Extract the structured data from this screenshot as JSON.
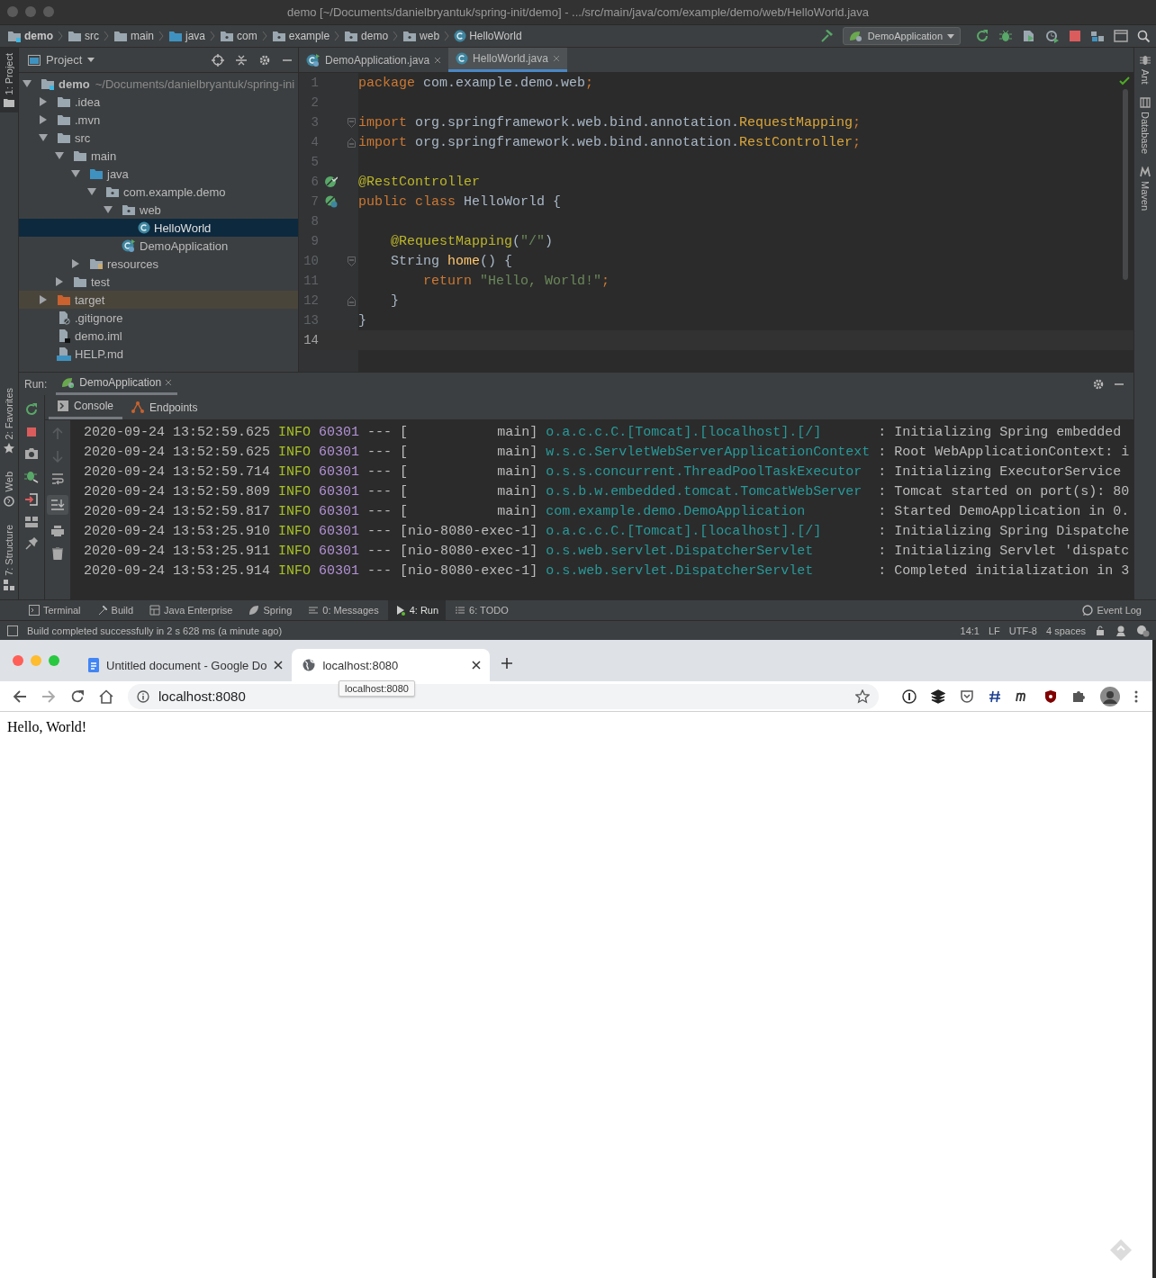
{
  "ide": {
    "title": "demo [~/Documents/danielbryantuk/spring-init/demo] - .../src/main/java/com/example/demo/web/HelloWorld.java",
    "breadcrumbs": [
      {
        "label": "demo",
        "kind": "module"
      },
      {
        "label": "src",
        "kind": "folder"
      },
      {
        "label": "main",
        "kind": "folder"
      },
      {
        "label": "java",
        "kind": "source-folder"
      },
      {
        "label": "com",
        "kind": "package"
      },
      {
        "label": "example",
        "kind": "package"
      },
      {
        "label": "demo",
        "kind": "package"
      },
      {
        "label": "web",
        "kind": "package"
      },
      {
        "label": "HelloWorld",
        "kind": "class"
      }
    ],
    "run_config": "DemoApplication",
    "left_tool_windows": [
      {
        "label": "1: Project",
        "selected": true,
        "kind": "project"
      },
      {
        "label": "2: Favorites",
        "selected": false,
        "kind": "favorites"
      },
      {
        "label": "Web",
        "selected": false,
        "kind": "web"
      },
      {
        "label": "7: Structure",
        "selected": false,
        "kind": "structure"
      }
    ],
    "right_tool_windows": [
      {
        "label": "Ant",
        "kind": "ant"
      },
      {
        "label": "Database",
        "kind": "database"
      },
      {
        "label": "Maven",
        "kind": "maven"
      }
    ],
    "project_panel": {
      "title": "Project",
      "tree": [
        {
          "label": "demo",
          "path": "~/Documents/danielbryantuk/spring-ini",
          "kind": "module",
          "expanded": true,
          "selected": false,
          "children": [
            {
              "label": ".idea",
              "kind": "folder",
              "expanded": false,
              "selected": false
            },
            {
              "label": ".mvn",
              "kind": "folder",
              "expanded": false,
              "selected": false
            },
            {
              "label": "src",
              "kind": "folder",
              "expanded": true,
              "selected": false,
              "children": [
                {
                  "label": "main",
                  "kind": "folder",
                  "expanded": true,
                  "selected": false,
                  "children": [
                    {
                      "label": "java",
                      "kind": "source-folder",
                      "expanded": true,
                      "selected": false,
                      "children": [
                        {
                          "label": "com.example.demo",
                          "kind": "package",
                          "expanded": true,
                          "selected": false,
                          "children": [
                            {
                              "label": "web",
                              "kind": "package",
                              "expanded": true,
                              "selected": false,
                              "children": [
                                {
                                  "label": "HelloWorld",
                                  "kind": "class",
                                  "selected": true
                                }
                              ]
                            },
                            {
                              "label": "DemoApplication",
                              "kind": "spring-app",
                              "selected": false
                            }
                          ]
                        }
                      ]
                    },
                    {
                      "label": "resources",
                      "kind": "resources-folder",
                      "expanded": false,
                      "selected": false
                    }
                  ]
                },
                {
                  "label": "test",
                  "kind": "folder",
                  "expanded": false,
                  "selected": false
                }
              ]
            },
            {
              "label": "target",
              "kind": "excluded-folder",
              "expanded": false,
              "selected": false
            },
            {
              "label": ".gitignore",
              "kind": "ignore-file",
              "selected": false
            },
            {
              "label": "demo.iml",
              "kind": "iml-file",
              "selected": false
            },
            {
              "label": "HELP.md",
              "kind": "md-file",
              "selected": false
            }
          ]
        }
      ]
    },
    "editor": {
      "tabs": [
        {
          "label": "DemoApplication.java",
          "kind": "spring-app",
          "selected": false
        },
        {
          "label": "HelloWorld.java",
          "kind": "class",
          "selected": true
        }
      ],
      "lines": [
        {
          "number": "1",
          "current": false,
          "tokens": [
            {
              "kind": "keyword",
              "text": "package"
            },
            {
              "kind": "plain",
              "text": " com.example.demo.web"
            },
            {
              "kind": "keyword",
              "text": ";"
            }
          ]
        },
        {
          "number": "2",
          "current": false
        },
        {
          "number": "3",
          "current": false,
          "fold": {
            "kind": "start"
          },
          "tokens": [
            {
              "kind": "keyword",
              "text": "import"
            },
            {
              "kind": "plain",
              "text": " org.springframework.web.bind.annotation."
            },
            {
              "kind": "class-ref",
              "text": "RequestMapping"
            },
            {
              "kind": "keyword",
              "text": ";"
            }
          ]
        },
        {
          "number": "4",
          "current": false,
          "fold": {
            "kind": "end"
          },
          "tokens": [
            {
              "kind": "keyword",
              "text": "import"
            },
            {
              "kind": "plain",
              "text": " org.springframework.web.bind.annotation."
            },
            {
              "kind": "class-ref",
              "text": "RestController"
            },
            {
              "kind": "keyword",
              "text": ";"
            }
          ]
        },
        {
          "number": "5",
          "current": false
        },
        {
          "number": "6",
          "current": false,
          "gutter_icon": {
            "kind": "bean"
          },
          "tokens": [
            {
              "kind": "annotation",
              "text": "@RestController"
            }
          ]
        },
        {
          "number": "7",
          "current": false,
          "gutter_icon": {
            "kind": "bean-class"
          },
          "tokens": [
            {
              "kind": "keyword",
              "text": "public class"
            },
            {
              "kind": "plain",
              "text": " HelloWorld {"
            }
          ]
        },
        {
          "number": "8",
          "current": false
        },
        {
          "number": "9",
          "current": false,
          "tokens": [
            {
              "kind": "annotation",
              "text": "    @RequestMapping"
            },
            {
              "kind": "plain",
              "text": "("
            },
            {
              "kind": "string",
              "text": "\"/\""
            },
            {
              "kind": "plain",
              "text": ")"
            }
          ]
        },
        {
          "number": "10",
          "current": false,
          "fold": {
            "kind": "start"
          },
          "tokens": [
            {
              "kind": "plain",
              "text": "    String "
            },
            {
              "kind": "method",
              "text": "home"
            },
            {
              "kind": "plain",
              "text": "() {"
            }
          ]
        },
        {
          "number": "11",
          "current": false,
          "tokens": [
            {
              "kind": "keyword",
              "text": "        return"
            },
            {
              "kind": "string",
              "text": " \"Hello, World!\""
            },
            {
              "kind": "keyword",
              "text": ";"
            }
          ]
        },
        {
          "number": "12",
          "current": false,
          "fold": {
            "kind": "end"
          },
          "tokens": [
            {
              "kind": "plain",
              "text": "    }"
            }
          ]
        },
        {
          "number": "13",
          "current": false,
          "tokens": [
            {
              "kind": "plain",
              "text": "}"
            }
          ]
        },
        {
          "number": "14",
          "current": true
        }
      ]
    },
    "run_panel": {
      "label": "Run:",
      "tab": "DemoApplication",
      "subtabs": [
        {
          "label": "Console",
          "kind": "console",
          "selected": true
        },
        {
          "label": "Endpoints",
          "kind": "endpoints",
          "selected": false
        }
      ],
      "log": [
        {
          "time": "2020-09-24 13:52:59.625",
          "level": "INFO",
          "pid": "60301",
          "sep": "---",
          "thread": "[           main]",
          "logger": "o.a.c.c.C.[Tomcat].[localhost].[/]",
          "message": ": Initializing Spring embedded"
        },
        {
          "time": "2020-09-24 13:52:59.625",
          "level": "INFO",
          "pid": "60301",
          "sep": "---",
          "thread": "[           main]",
          "logger": "w.s.c.ServletWebServerApplicationContext",
          "message": ": Root WebApplicationContext: i"
        },
        {
          "time": "2020-09-24 13:52:59.714",
          "level": "INFO",
          "pid": "60301",
          "sep": "---",
          "thread": "[           main]",
          "logger": "o.s.s.concurrent.ThreadPoolTaskExecutor",
          "message": ": Initializing ExecutorService"
        },
        {
          "time": "2020-09-24 13:52:59.809",
          "level": "INFO",
          "pid": "60301",
          "sep": "---",
          "thread": "[           main]",
          "logger": "o.s.b.w.embedded.tomcat.TomcatWebServer",
          "message": ": Tomcat started on port(s): 80"
        },
        {
          "time": "2020-09-24 13:52:59.817",
          "level": "INFO",
          "pid": "60301",
          "sep": "---",
          "thread": "[           main]",
          "logger": "com.example.demo.DemoApplication",
          "message": ": Started DemoApplication in 0."
        },
        {
          "time": "2020-09-24 13:53:25.910",
          "level": "INFO",
          "pid": "60301",
          "sep": "---",
          "thread": "[nio-8080-exec-1]",
          "logger": "o.a.c.c.C.[Tomcat].[localhost].[/]",
          "message": ": Initializing Spring Dispatche"
        },
        {
          "time": "2020-09-24 13:53:25.911",
          "level": "INFO",
          "pid": "60301",
          "sep": "---",
          "thread": "[nio-8080-exec-1]",
          "logger": "o.s.web.servlet.DispatcherServlet",
          "message": ": Initializing Servlet 'dispatc"
        },
        {
          "time": "2020-09-24 13:53:25.914",
          "level": "INFO",
          "pid": "60301",
          "sep": "---",
          "thread": "[nio-8080-exec-1]",
          "logger": "o.s.web.servlet.DispatcherServlet",
          "message": ": Completed initialization in 3"
        }
      ]
    },
    "tool_tabs": [
      {
        "label": "Terminal",
        "kind": "terminal",
        "selected": false
      },
      {
        "label": "Build",
        "kind": "build",
        "selected": false
      },
      {
        "label": "Java Enterprise",
        "kind": "enterprise",
        "selected": false
      },
      {
        "label": "Spring",
        "kind": "spring",
        "selected": false
      },
      {
        "label": "0: Messages",
        "kind": "messages",
        "selected": false
      },
      {
        "label": "4: Run",
        "kind": "run",
        "selected": true
      },
      {
        "label": "6: TODO",
        "kind": "todo",
        "selected": false
      }
    ],
    "event_log": "Event Log",
    "status_bar": {
      "message": "Build completed successfully in 2 s 628 ms (a minute ago)",
      "position": "14:1",
      "line_separator": "LF",
      "encoding": "UTF-8",
      "indent": "4 spaces"
    }
  },
  "browser": {
    "tabs": [
      {
        "title": "Untitled document - Google Do",
        "kind": "docs",
        "selected": false
      },
      {
        "title": "localhost:8080",
        "kind": "web",
        "selected": true
      }
    ],
    "address": "localhost:8080",
    "tooltip": "localhost:8080",
    "page_text": "Hello, World!"
  }
}
